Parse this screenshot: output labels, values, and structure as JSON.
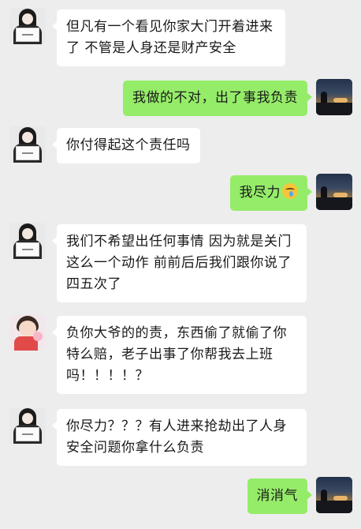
{
  "messages": [
    {
      "side": "in",
      "avatar": "girl-with-sign-avatar",
      "text": "但凡有一个看见你家大门开着进来了 不管是人身还是财产安全"
    },
    {
      "side": "out",
      "avatar": "sunset-skyline-avatar",
      "text": "我做的不对，出了事我负责"
    },
    {
      "side": "in",
      "avatar": "girl-with-sign-avatar",
      "text": "你付得起这个责任吗"
    },
    {
      "side": "out",
      "avatar": "sunset-skyline-avatar",
      "text": "我尽力",
      "emoji": "crying-laugh-emoji"
    },
    {
      "side": "in",
      "avatar": "girl-with-sign-avatar",
      "text": "我们不希望出任何事情 因为就是关门这么一个动作 前前后后我们跟你说了四五次了"
    },
    {
      "side": "in",
      "avatar": "child-avatar",
      "text": "负你大爷的的责，东西偷了就偷了你特么赔，老子出事了你帮我去上班吗！！！！？"
    },
    {
      "side": "in",
      "avatar": "girl-with-sign-avatar",
      "text": "你尽力？？？有人进来抢劫出了人身安全问题你拿什么负责"
    },
    {
      "side": "out",
      "avatar": "sunset-skyline-avatar",
      "text": "消消气"
    }
  ],
  "colors": {
    "background": "#ededed",
    "incoming_bubble": "#ffffff",
    "outgoing_bubble": "#95ec69"
  }
}
